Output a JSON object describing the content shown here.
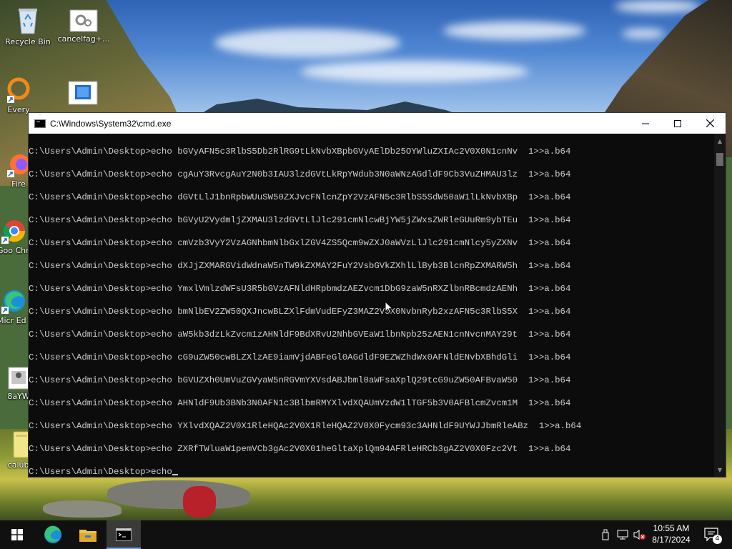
{
  "desktop": {
    "icons": [
      {
        "label": "Recycle Bin",
        "icon": "recycle-bin-icon"
      },
      {
        "label": "cancelfag+...",
        "icon": "settings-file-icon"
      },
      {
        "label": "Every",
        "icon": "everything-icon"
      },
      {
        "label": "",
        "icon": "app-window-icon"
      },
      {
        "label": "Fire",
        "icon": "firefox-icon"
      },
      {
        "label": "Goo Chro",
        "icon": "chrome-icon"
      },
      {
        "label": "Micr Ed",
        "icon": "edge-icon"
      },
      {
        "label": "8aYW",
        "icon": "image-file-icon"
      },
      {
        "label": "calubjs",
        "icon": "text-file-icon"
      }
    ]
  },
  "cmd": {
    "title": "C:\\Windows\\System32\\cmd.exe",
    "lines": [
      "C:\\Users\\Admin\\Desktop>echo bGVyAFN5c3RlbS5Db2RlRG9tLkNvbXBpbGVyAElDb25OYWluZXIAc2V0X0N1cnNv  1>>a.b64",
      "C:\\Users\\Admin\\Desktop>echo cgAuY3RvcgAuY2N0b3IAU3lzdGVtLkRpYWdub3N0aWNzAGdldF9Cb3VuZHMAU3lz  1>>a.b64",
      "C:\\Users\\Admin\\Desktop>echo dGVtLlJ1bnRpbWUuSW50ZXJvcFNlcnZpY2VzAFN5c3RlbS5SdW50aW1lLkNvbXBp  1>>a.b64",
      "C:\\Users\\Admin\\Desktop>echo bGVyU2VydmljZXMAU3lzdGVtLlJlc291cmNlcwBjYW5jZWxsZWRleGUuRm9ybTEu  1>>a.b64",
      "C:\\Users\\Admin\\Desktop>echo cmVzb3VyY2VzAGNhbmNlbGxlZGV4ZS5Qcm9wZXJ0aWVzLlJlc291cmNlcy5yZXNv  1>>a.b64",
      "C:\\Users\\Admin\\Desktop>echo dXJjZXMARGVidWdnaW5nTW9kZXMAY2FuY2VsbGVkZXhlLlByb3BlcnRpZXMARW5h  1>>a.b64",
      "C:\\Users\\Admin\\Desktop>echo YmxlVmlzdWFsU3R5bGVzAFNldHRpbmdzAEZvcm1DbG9zaW5nRXZlbnRBcmdzAENh  1>>a.b64",
      "C:\\Users\\Admin\\Desktop>echo bmNlbEV2ZW50QXJncwBLZXlFdmVudEFyZ3MAZ2V0X0NvbnRyb2xzAFN5c3RlbS5X  1>>a.b64",
      "C:\\Users\\Admin\\Desktop>echo aW5kb3dzLkZvcm1zAHNldF9BdXRvU2NhbGVEaW1lbnNpb25zAEN1cnNvcnMAY29t  1>>a.b64",
      "C:\\Users\\Admin\\Desktop>echo cG9uZW50cwBLZXlzAE9iamVjdABFeGl0AGdldF9EZWZhdWx0AFNldENvbXBhdGli  1>>a.b64",
      "C:\\Users\\Admin\\Desktop>echo bGVUZXh0UmVuZGVyaW5nRGVmYXVsdABJbml0aWFsaXplQ29tcG9uZW50AFBvaW50  1>>a.b64",
      "C:\\Users\\Admin\\Desktop>echo AHNldF9Ub3BNb3N0AFN1c3BlbmRMYXlvdXQAUmVzdW1lTGF5b3V0AFBlcmZvcm1M  1>>a.b64",
      "C:\\Users\\Admin\\Desktop>echo YXlvdXQAZ2V0X1RleHQAc2V0X1RleHQAZ2V0X0Fycm93c3AHNldF9UYWJJbmRleABz  1>>a.b64",
      "C:\\Users\\Admin\\Desktop>echo ZXRfTWluaW1pemVCb3gAc2V0X01heGltaXplQm94AFRleHRCb3gAZ2V0X0Fzc2Vt  1>>a.b64"
    ],
    "prompt_line": "C:\\Users\\Admin\\Desktop>echo"
  },
  "taskbar": {
    "clock_time": "10:55 AM",
    "clock_date": "8/17/2024",
    "notification_count": "4"
  }
}
